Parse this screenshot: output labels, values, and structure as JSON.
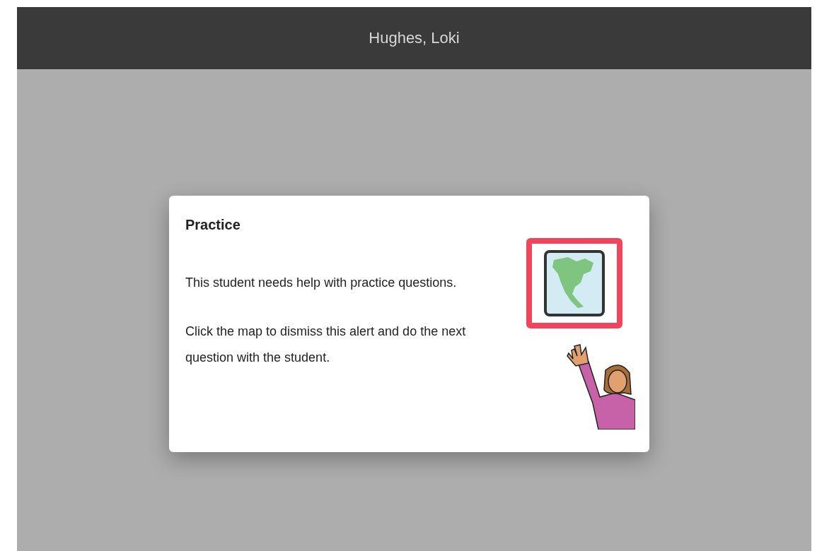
{
  "header": {
    "title": "Hughes, Loki"
  },
  "alert": {
    "title": "Practice",
    "paragraphs": [
      "This student needs help with practice questions.",
      "Click the map to dismiss this alert and do the next question with the student."
    ]
  }
}
